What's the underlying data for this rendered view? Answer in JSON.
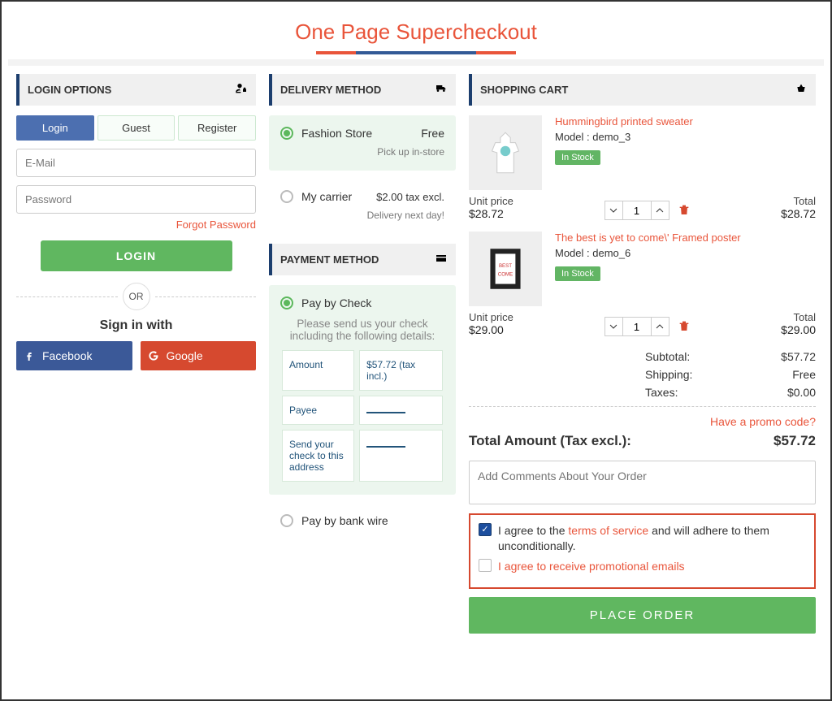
{
  "title": "One Page Supercheckout",
  "login": {
    "header": "LOGIN OPTIONS",
    "tabs": {
      "login": "Login",
      "guest": "Guest",
      "register": "Register"
    },
    "email_placeholder": "E-Mail",
    "password_placeholder": "Password",
    "forgot": "Forgot Password",
    "login_button": "LOGIN",
    "or": "OR",
    "sign_in_with": "Sign in with",
    "facebook": "Facebook",
    "google": "Google"
  },
  "delivery": {
    "header": "DELIVERY METHOD",
    "options": [
      {
        "name": "Fashion Store",
        "price": "Free",
        "note": "Pick up in-store",
        "selected": true
      },
      {
        "name": "My carrier",
        "price": "$2.00 tax excl.",
        "note": "Delivery next day!",
        "selected": false
      }
    ]
  },
  "payment": {
    "header": "PAYMENT METHOD",
    "options": {
      "check": {
        "label": "Pay by Check",
        "selected": true,
        "desc": "Please send us your check including the following details:",
        "rows": [
          {
            "key": "Amount",
            "val": "$57.72 (tax incl.)"
          },
          {
            "key": "Payee",
            "val": ""
          },
          {
            "key": "Send your check to this address",
            "val": ""
          }
        ]
      },
      "wire": {
        "label": "Pay by bank wire",
        "selected": false
      }
    }
  },
  "cart": {
    "header": "SHOPPING CART",
    "unit_price_label": "Unit price",
    "total_label": "Total",
    "items": [
      {
        "title": "Hummingbird printed sweater",
        "model": "Model : demo_3",
        "stock": "In Stock",
        "unit_price": "$28.72",
        "qty": "1",
        "total": "$28.72"
      },
      {
        "title": "The best is yet to come\\' Framed poster",
        "model": "Model : demo_6",
        "stock": "In Stock",
        "unit_price": "$29.00",
        "qty": "1",
        "total": "$29.00"
      }
    ],
    "totals": {
      "subtotal_label": "Subtotal:",
      "subtotal": "$57.72",
      "shipping_label": "Shipping:",
      "shipping": "Free",
      "taxes_label": "Taxes:",
      "taxes": "$0.00"
    },
    "promo": "Have a promo code?",
    "grand_label": "Total Amount (Tax excl.):",
    "grand_total": "$57.72",
    "comments_placeholder": "Add Comments About Your Order",
    "agree_terms_pre": "I agree to the ",
    "agree_terms_link": "terms of service",
    "agree_terms_post": " and will adhere to them unconditionally.",
    "agree_promo": "I agree to receive promotional emails",
    "place_order": "PLACE ORDER"
  }
}
